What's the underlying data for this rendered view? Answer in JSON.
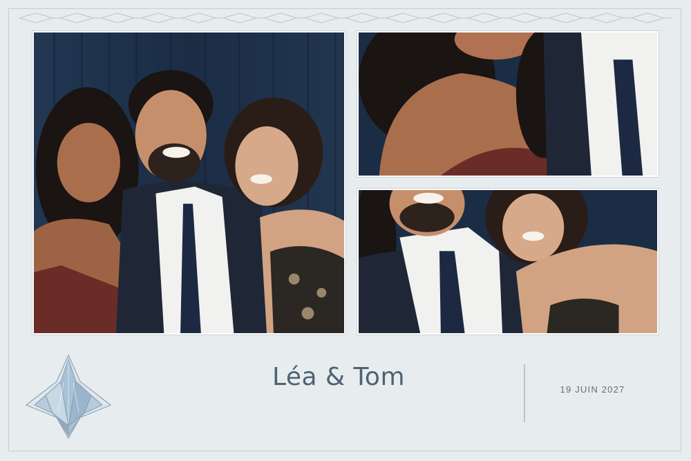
{
  "couple_names": "Léa & Tom",
  "date": "19 JUIN 2027",
  "colors": {
    "background": "#e7ecee",
    "text": "#4e6272",
    "curtain": "#1d2f45",
    "suit": "#1f2737",
    "dress": "#6a2c27"
  },
  "photos": [
    {
      "name": "photo-main",
      "subject": "three guests laughing in front of a navy curtain"
    },
    {
      "name": "photo-top-right",
      "subject": "close-up of two guests"
    },
    {
      "name": "photo-bottom-right",
      "subject": "man and woman laughing together"
    }
  ],
  "emblem_icon": "art-deco-crystal-emblem-icon"
}
